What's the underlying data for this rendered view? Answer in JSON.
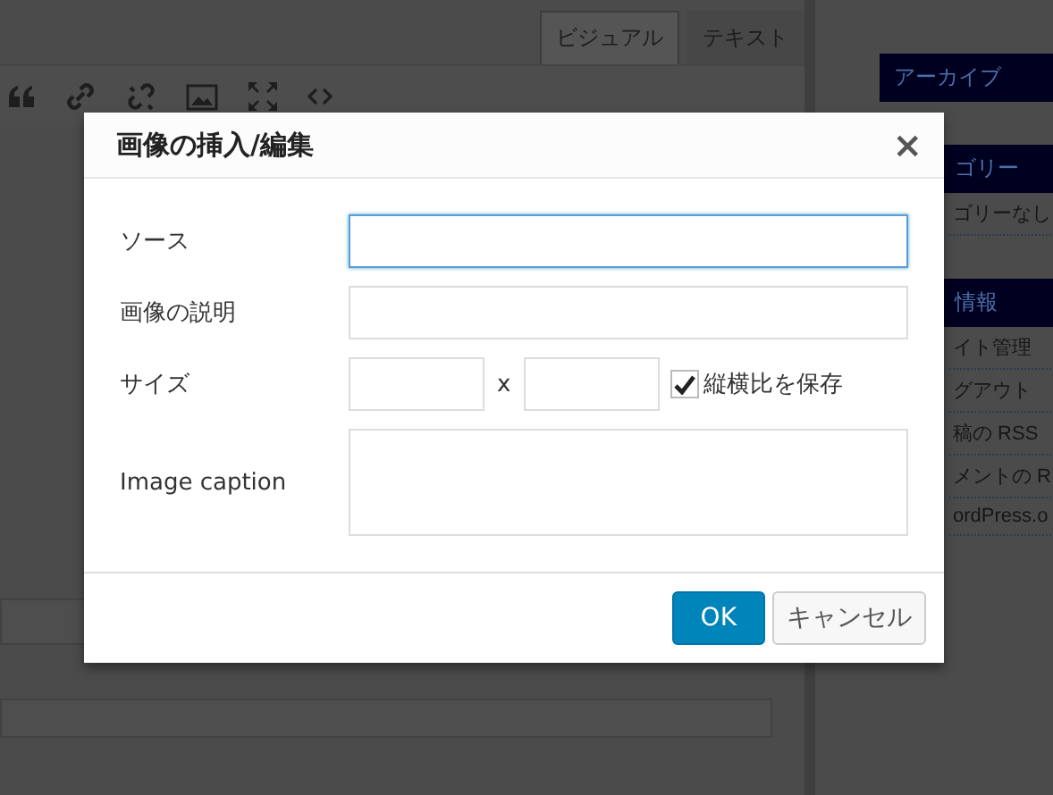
{
  "editor": {
    "tabs": [
      {
        "label": "ビジュアル",
        "selected": true
      },
      {
        "label": "テキスト",
        "selected": false
      }
    ],
    "toolbar": [
      {
        "kind": "quote"
      },
      {
        "kind": "link"
      },
      {
        "kind": "unlink"
      },
      {
        "kind": "image"
      },
      {
        "kind": "fullscreen"
      },
      {
        "kind": "code"
      }
    ]
  },
  "sidebar": {
    "sections": [
      {
        "title": "アーカイブ"
      },
      {
        "title": "ゴリー",
        "items": [
          "ゴリーなし"
        ]
      },
      {
        "title": "情報",
        "items": [
          "イト管理",
          "グアウト",
          "稿の RSS",
          "メントの R",
          "ordPress.o"
        ]
      }
    ]
  },
  "dialog": {
    "title": "画像の挿入/編集",
    "close": "×",
    "fields": [
      {
        "kind": "text",
        "label": "ソース",
        "focused": true
      },
      {
        "kind": "text",
        "label": "画像の説明",
        "focused": false
      },
      {
        "kind": "size",
        "label": "サイズ",
        "separator": "x",
        "checkbox": {
          "label": "縦横比を保存",
          "checked": true
        }
      },
      {
        "kind": "textarea",
        "label": "Image caption",
        "focused": false
      }
    ],
    "buttons": [
      {
        "label": "OK",
        "kind": "primary"
      },
      {
        "label": "キャンセル",
        "kind": "secondary"
      }
    ]
  }
}
